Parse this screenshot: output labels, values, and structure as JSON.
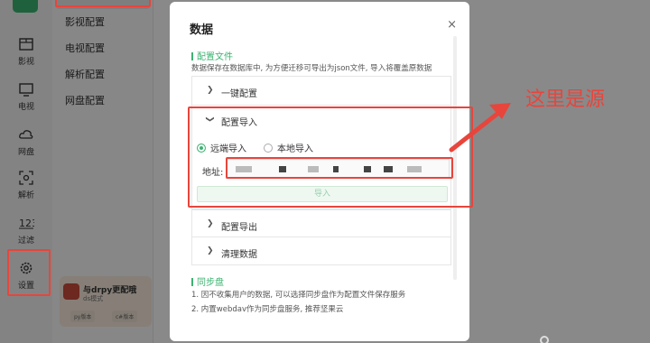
{
  "rail": {
    "items": [
      {
        "label": "影视",
        "icon": "film-icon"
      },
      {
        "label": "电视",
        "icon": "tv-icon"
      },
      {
        "label": "网盘",
        "icon": "cloud-icon"
      },
      {
        "label": "解析",
        "icon": "parse-icon"
      },
      {
        "label": "过滤",
        "icon": "filter-icon"
      },
      {
        "label": "设置",
        "icon": "gear-icon"
      }
    ]
  },
  "submenu": {
    "items": [
      "影视配置",
      "电视配置",
      "解析配置",
      "网盘配置"
    ]
  },
  "promo": {
    "title": "与drpy更配哦",
    "subtitle": "ds模式",
    "tag_left": "py版本",
    "tag_right": "c#版本"
  },
  "dialog": {
    "title": "数据",
    "close": "×",
    "config_section": {
      "head": "配置文件",
      "desc": "数据保存在数据库中, 为方便迁移可导出为json文件, 导入将覆盖原数据"
    },
    "accordion": {
      "one_click": "一键配置",
      "import": "配置导入",
      "export": "配置导出",
      "clear": "清理数据"
    },
    "import_panel": {
      "remote": "远端导入",
      "local": "本地导入",
      "address_label": "地址:",
      "button": "导入"
    },
    "sync_section": {
      "head": "同步盘",
      "line1": "1. 因不收集用户的数据, 可以选择同步盘作为配置文件保存服务",
      "line2": "2. 内置webdav作为同步盘服务, 推荐坚果云"
    }
  },
  "annotation": {
    "text": "这里是源",
    "color": "#e8453c"
  },
  "colors": {
    "accent": "#3cb371",
    "annotation": "#e8453c"
  }
}
